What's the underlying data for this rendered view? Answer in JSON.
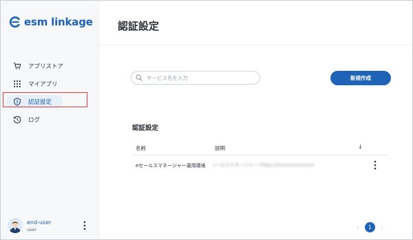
{
  "app": {
    "logo_text": "esm linkage"
  },
  "sidebar": {
    "items": [
      {
        "label": "アプリストア",
        "icon": "cart-icon",
        "active": false
      },
      {
        "label": "マイアプリ",
        "icon": "grid-icon",
        "active": false
      },
      {
        "label": "認証設定",
        "icon": "shield-icon",
        "active": true
      },
      {
        "label": "ログ",
        "icon": "history-icon",
        "active": false
      }
    ],
    "user": {
      "name": "end-user",
      "role": "user"
    }
  },
  "header": {
    "title": "認証設定"
  },
  "search": {
    "placeholder": "サービス名を入力",
    "value": ""
  },
  "toolbar": {
    "new_label": "新規作成"
  },
  "section": {
    "title": "認証設定"
  },
  "table": {
    "columns": {
      "name": "名前",
      "description": "説明",
      "sort_icon": "↓"
    },
    "rows": [
      {
        "name": "eセールスマネージャー運用環境",
        "description": "(ールスマネージャー https://xxxxxxxxxxxxx"
      }
    ]
  },
  "pagination": {
    "prev": "‹",
    "current": "1",
    "next": "›"
  },
  "colors": {
    "accent": "#1f63b6",
    "highlight": "#e53935",
    "active_bg": "#e6f0fb"
  }
}
